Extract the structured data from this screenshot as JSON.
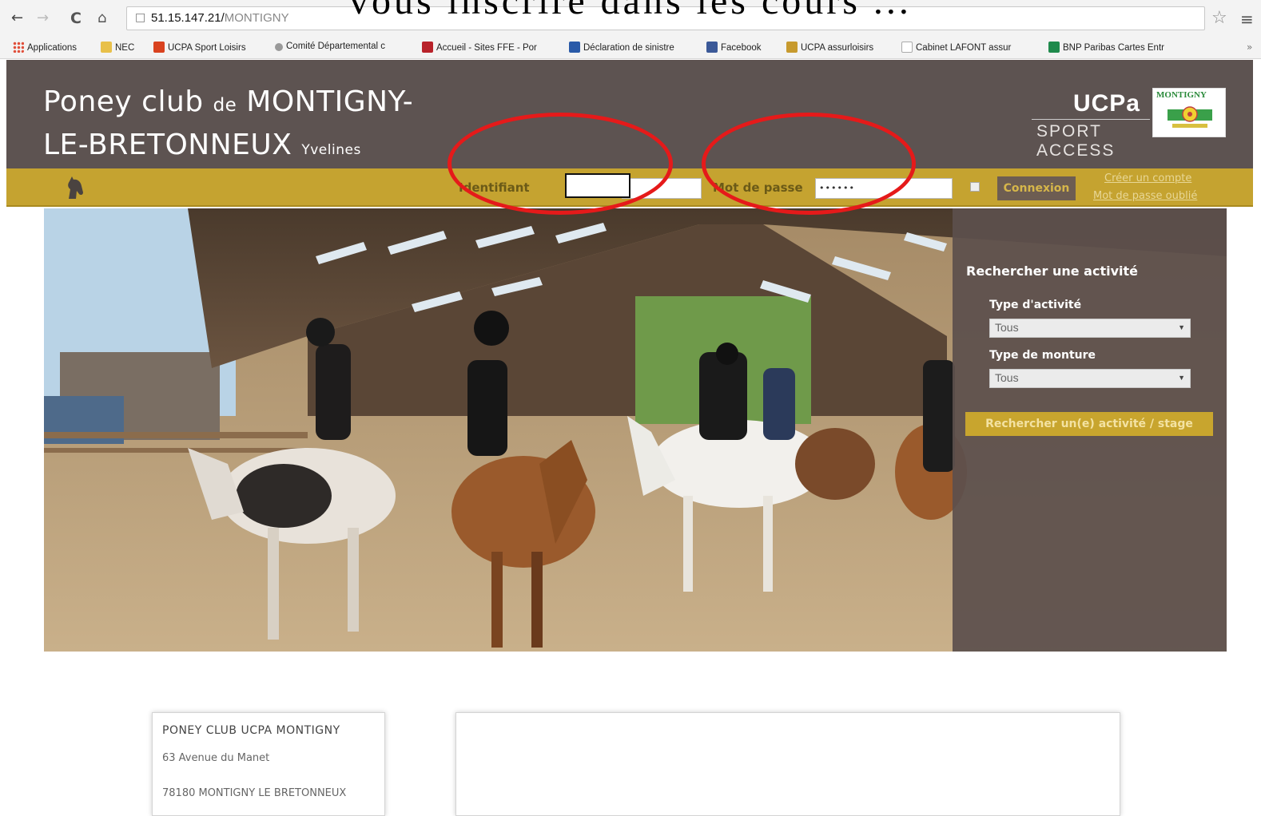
{
  "overlay": {
    "title": "vous inscrire dans les cours ..."
  },
  "browser": {
    "url_host": "51.15.147.21/",
    "url_path": "MONTIGNY",
    "bookmarks": [
      {
        "label": "Applications",
        "color": "#e04e39"
      },
      {
        "label": "NEC",
        "color": "#e8c04a"
      },
      {
        "label": "UCPA Sport Loisirs",
        "color": "#d9421f"
      },
      {
        "label": "Comité Départemental c",
        "color": "#777777"
      },
      {
        "label": "Accueil - Sites FFE - Por",
        "color": "#b8222a"
      },
      {
        "label": "Déclaration de sinistre",
        "color": "#2a5aa8"
      },
      {
        "label": "Facebook",
        "color": "#3b5998"
      },
      {
        "label": "UCPA assurloisirs",
        "color": "#c79a2e"
      },
      {
        "label": "Cabinet LAFONT assur",
        "color": "#aaaaaa"
      },
      {
        "label": "BNP Paribas Cartes Entr",
        "color": "#1f8a4c"
      }
    ],
    "bookmarks_more": "»"
  },
  "header": {
    "title_line1_a": "Poney club ",
    "title_line1_b": "de",
    "title_line1_c": " MONTIGNY-",
    "title_line2_a": "LE-BRETONNEUX ",
    "title_line2_b": "Yvelines",
    "ucpa_word": "UCPa",
    "ucpa_sub": "SPORT ACCESS",
    "montigny_logo_text": "MONTIGNY"
  },
  "login": {
    "id_label": "Identifiant",
    "id_value": "",
    "password_label": "Mot de passe",
    "password_value": "••••••",
    "button_label": "Connexion",
    "create_account": "Créer un compte",
    "forgot_password": "Mot de passe oublié"
  },
  "search": {
    "title": "Rechercher une activité",
    "activity_label": "Type d'activité",
    "activity_value": "Tous",
    "mount_label": "Type de monture",
    "mount_value": "Tous",
    "button_label": "Rechercher un(e) activité / stage"
  },
  "address": {
    "name": "PONEY CLUB UCPA MONTIGNY",
    "street": "63 Avenue du Manet",
    "city": "78180 MONTIGNY LE BRETONNEUX"
  },
  "colors": {
    "header_bg": "#5d5351",
    "login_bar_bg": "#c5a330",
    "annotation_red": "#e51a1a"
  }
}
